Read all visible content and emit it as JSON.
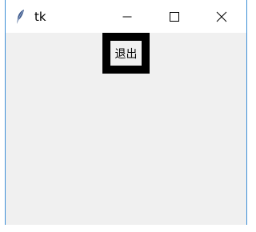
{
  "window": {
    "title": "tk",
    "icon": "tk-feather-icon",
    "controls": {
      "minimize": "minimize-icon",
      "maximize": "maximize-icon",
      "close": "close-icon"
    }
  },
  "content": {
    "exit_button_label": "退出"
  },
  "colors": {
    "window_border": "#3c8fd6",
    "titlebar_bg": "#ffffff",
    "content_bg": "#f0f0f0",
    "button_frame": "#000000"
  }
}
